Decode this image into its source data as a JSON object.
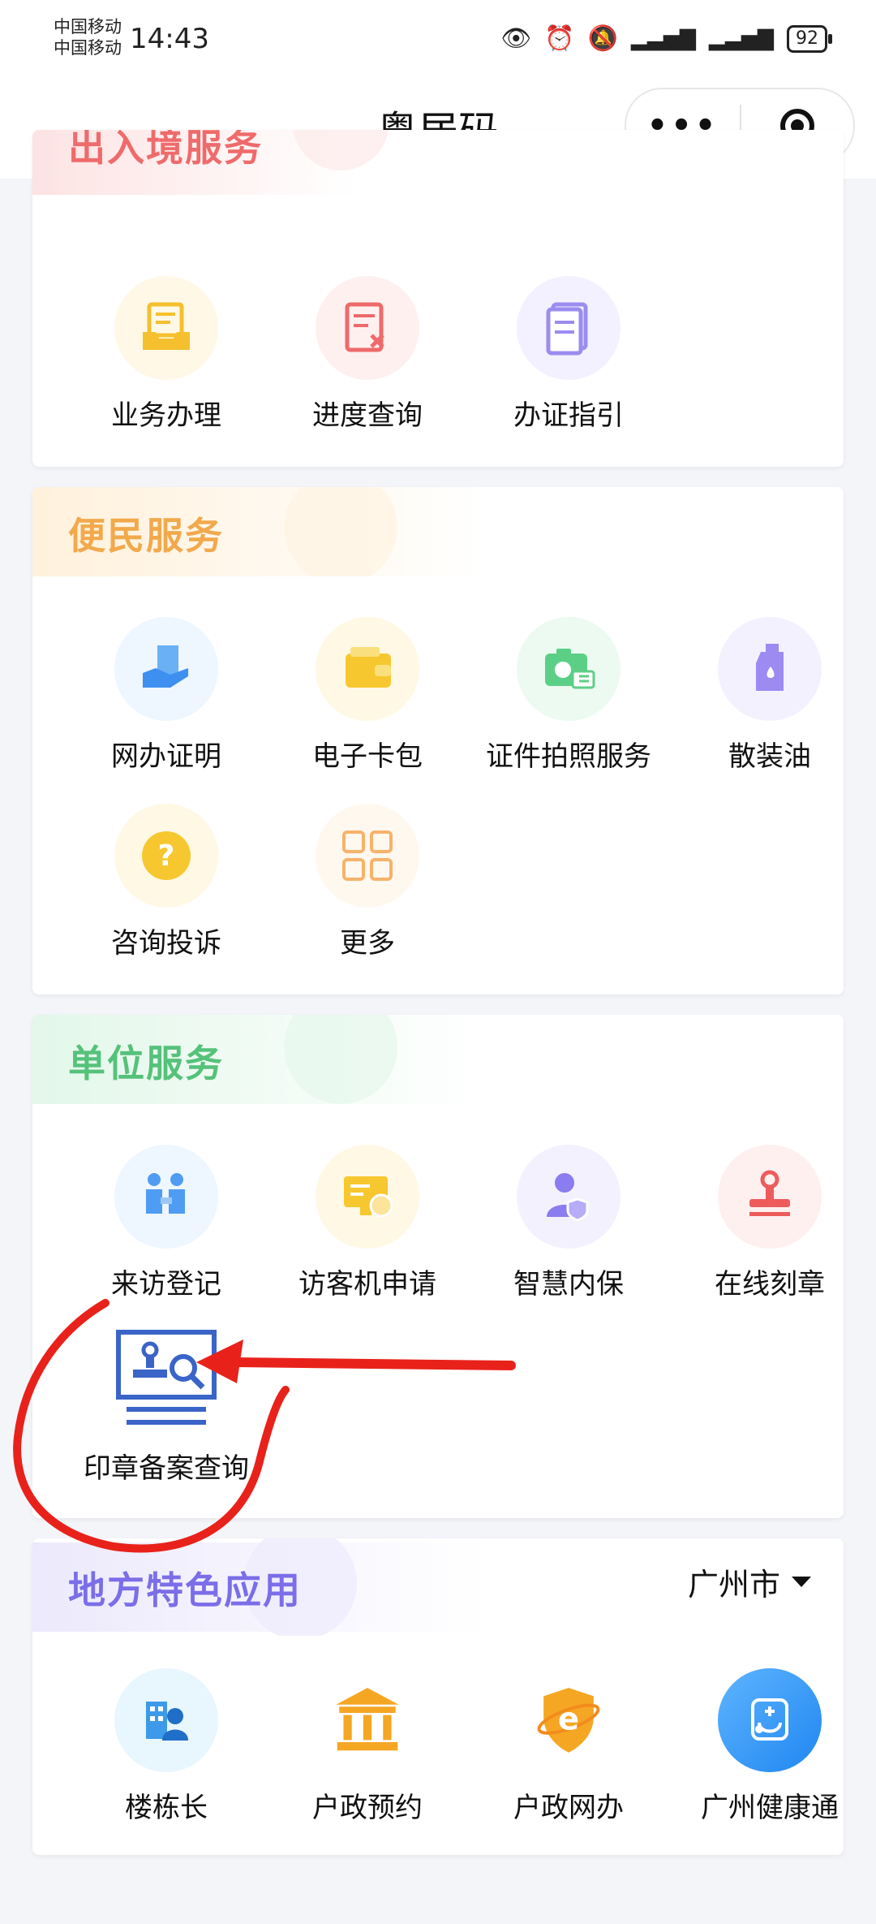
{
  "status": {
    "carrier1": "中国移动",
    "carrier2": "中国移动",
    "time": "14:43",
    "battery": "92"
  },
  "nav": {
    "title": "粤居码"
  },
  "sections": [
    {
      "title": "出入境服务",
      "items": [
        "业务办理",
        "进度查询",
        "办证指引"
      ]
    },
    {
      "title": "便民服务",
      "items": [
        "网办证明",
        "电子卡包",
        "证件拍照服务",
        "散装油",
        "咨询投诉",
        "更多"
      ]
    },
    {
      "title": "单位服务",
      "items": [
        "来访登记",
        "访客机申请",
        "智慧内保",
        "在线刻章",
        "印章备案查询"
      ]
    },
    {
      "title": "地方特色应用",
      "city": "广州市",
      "items": [
        "楼栋长",
        "户政预约",
        "户政网办",
        "广州健康通"
      ]
    }
  ],
  "colors": {
    "exit_title": "#ef6b6b",
    "civil_title": "#f2a94c",
    "unit_title": "#55c27a",
    "local_title": "#7b6ee8",
    "annotation": "#e8221b"
  }
}
